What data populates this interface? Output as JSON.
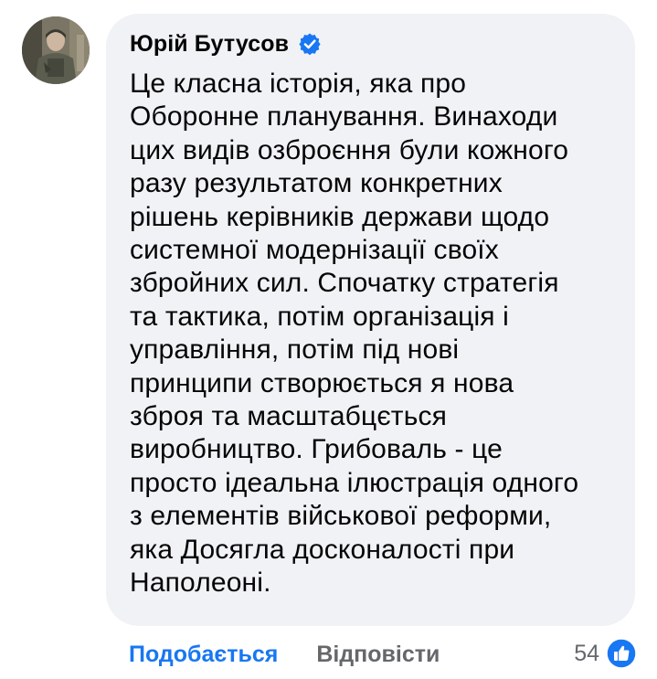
{
  "comment": {
    "author": "Юрій Бутусов",
    "verified": true,
    "text": "Це класна історія, яка про\nОборонне планування. Винаходи\nцих видів озброєння були кожного\nразу результатом конкретних\nрішень керівників держави щодо\nсистемної модернізації своїх\nзбройних сил. Спочатку стратегія\nта тактика, потім організація і\nуправління, потім під нові\nпринципи створюється я нова\nзброя та масштабцється\nвиробництво. Грибоваль - це\nпросто ідеальна ілюстрація одного\nз елементів військової реформи,\nяка Досягла досконалості при\nНаполеоні."
  },
  "actions": {
    "like_label": "Подобається",
    "reply_label": "Відповісти"
  },
  "reactions": {
    "count": "54",
    "icon": "like-icon"
  },
  "colors": {
    "accent": "#1877f2",
    "bubble_bg": "#f0f2f5",
    "secondary_text": "#65676b",
    "primary_text": "#050505"
  }
}
